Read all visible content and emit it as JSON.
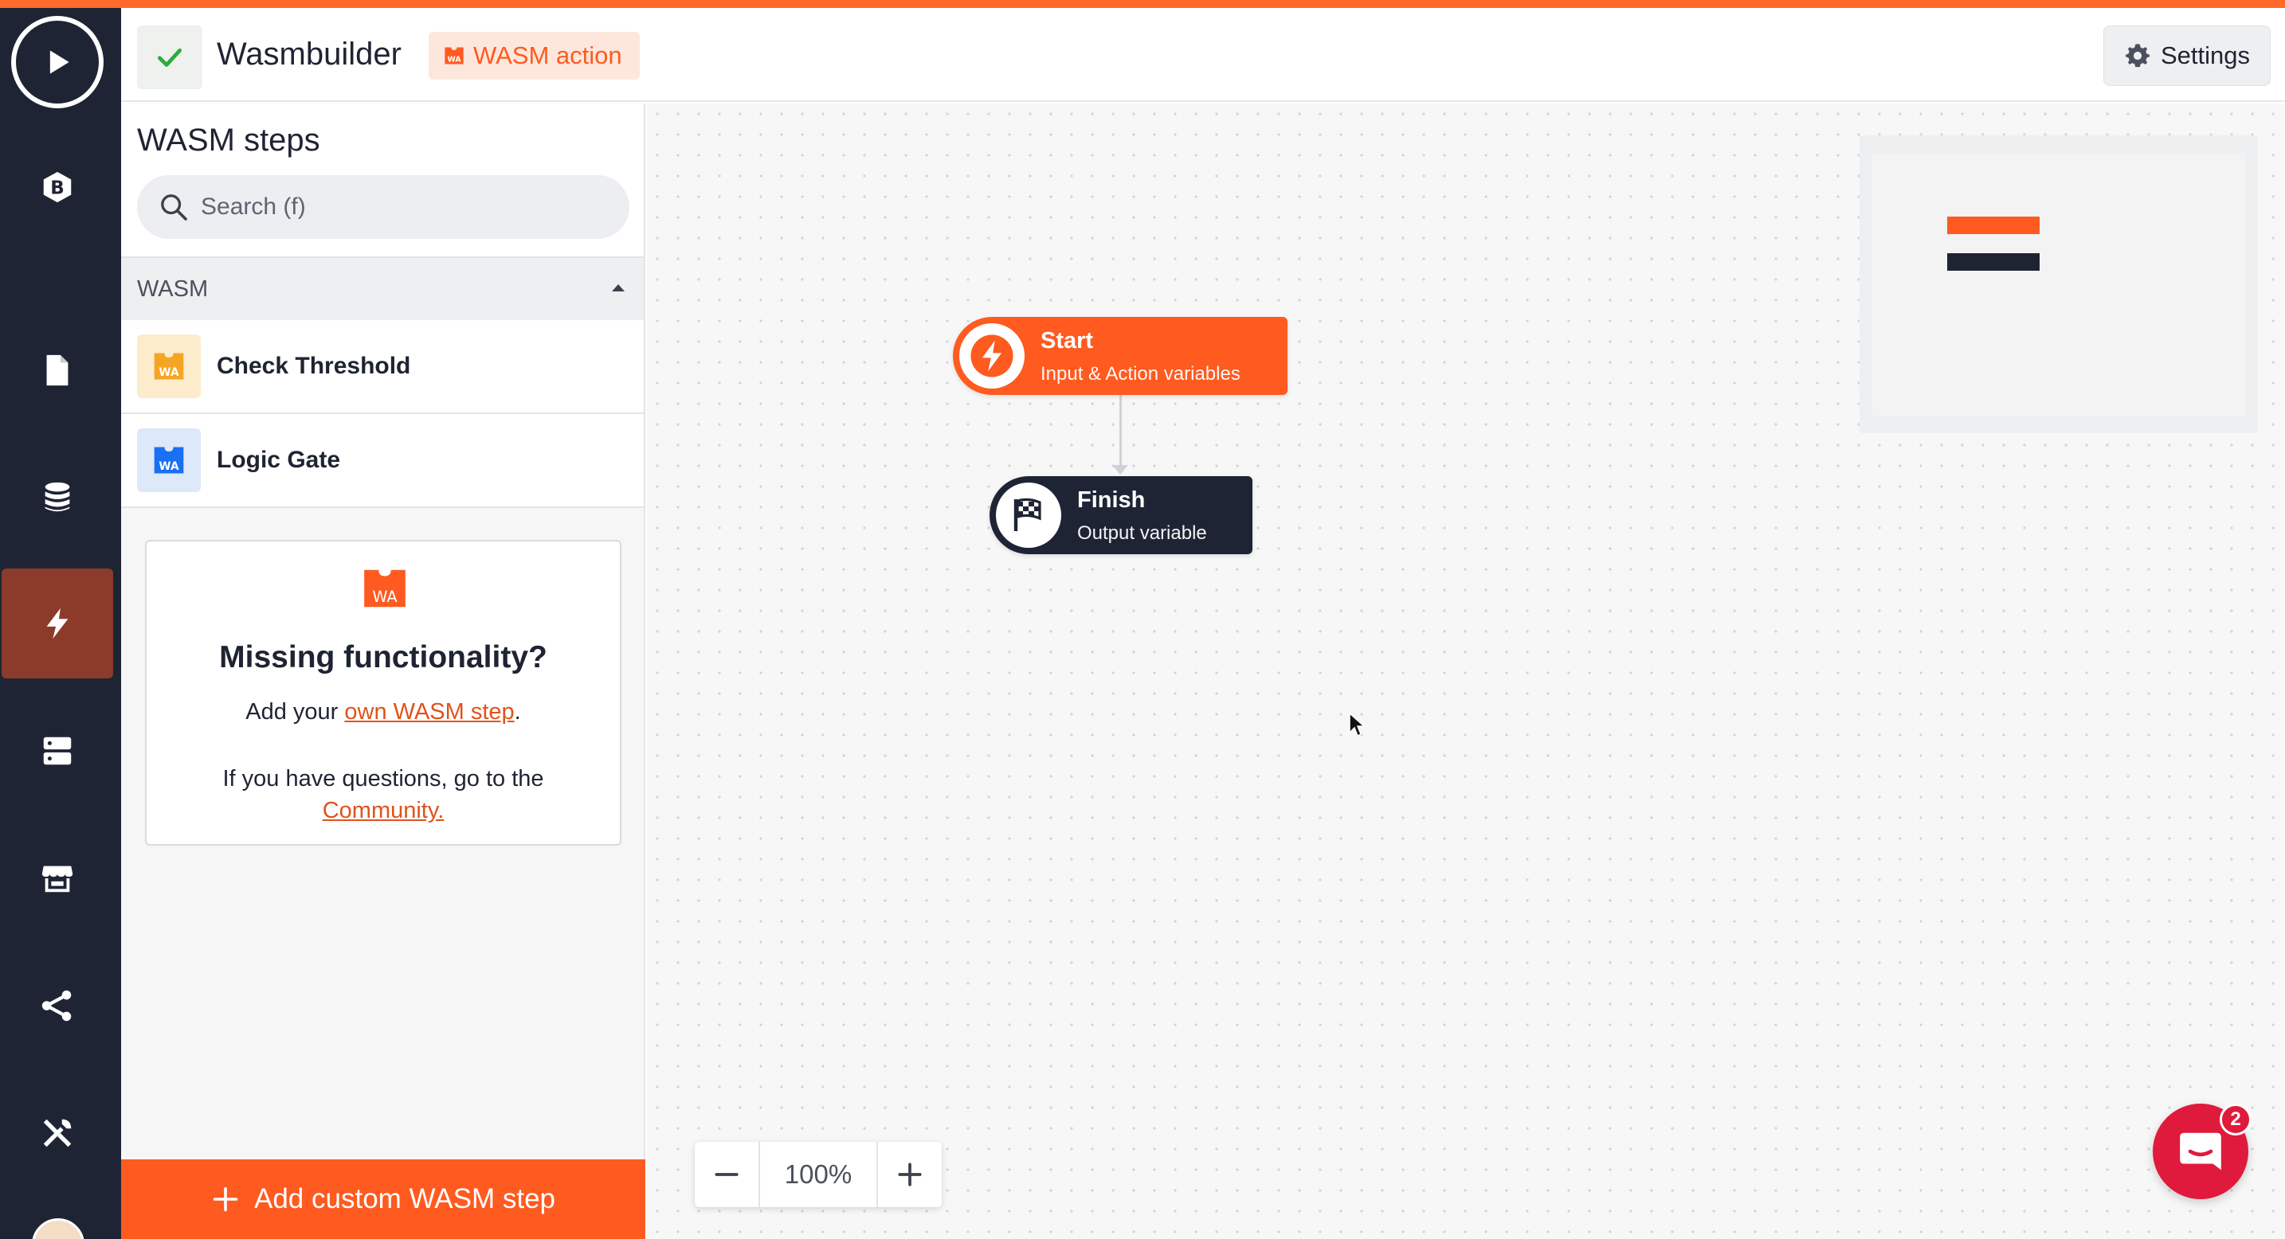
{
  "header": {
    "title": "Wasmbuilder",
    "badge_label": "WASM action",
    "settings_label": "Settings"
  },
  "nav": {
    "logo_letter": "B"
  },
  "panel": {
    "title": "WASM steps",
    "search_placeholder": "Search (f)",
    "group_label": "WASM",
    "steps": [
      {
        "label": "Check Threshold",
        "icon_text": "WA",
        "color": "#f5a524"
      },
      {
        "label": "Logic Gate",
        "icon_text": "WA",
        "color": "#1a6ff2"
      }
    ],
    "help": {
      "icon_text": "WA",
      "title": "Missing functionality?",
      "line1_prefix": "Add your ",
      "line1_link": "own WASM step",
      "line1_suffix": ".",
      "line2_text": "If you have questions, go to the",
      "line2_link": "Community."
    },
    "add_button_label": "Add custom WASM step"
  },
  "canvas": {
    "start_node": {
      "title": "Start",
      "subtitle": "Input & Action variables"
    },
    "finish_node": {
      "title": "Finish",
      "subtitle": "Output variable"
    },
    "zoom_level": "100%"
  },
  "chat": {
    "badge_count": "2"
  },
  "colors": {
    "accent": "#ff5a1f",
    "nav_bg": "#1f2435",
    "nav_active": "#8c3b2b",
    "chat": "#e01a3c"
  }
}
